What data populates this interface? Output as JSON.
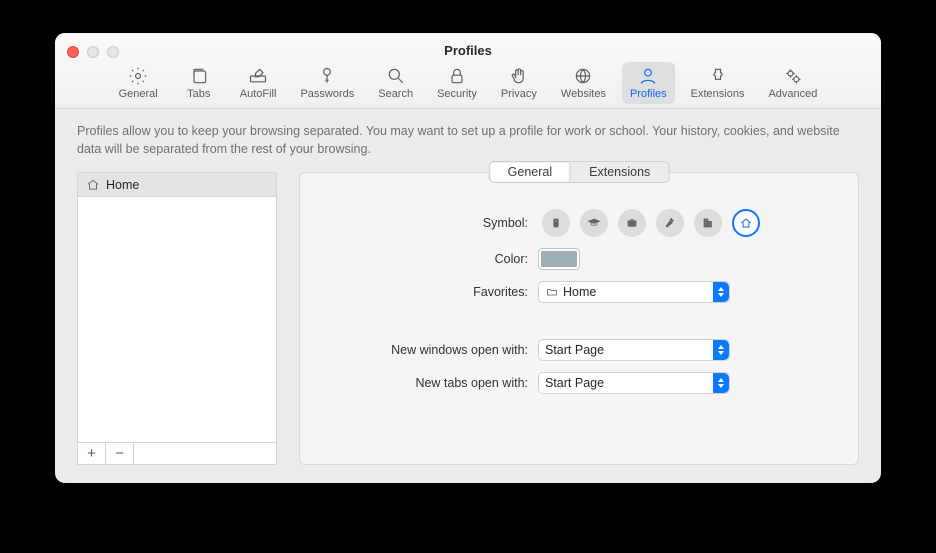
{
  "window": {
    "title": "Profiles"
  },
  "toolbar": {
    "items": [
      {
        "label": "General"
      },
      {
        "label": "Tabs"
      },
      {
        "label": "AutoFill"
      },
      {
        "label": "Passwords"
      },
      {
        "label": "Search"
      },
      {
        "label": "Security"
      },
      {
        "label": "Privacy"
      },
      {
        "label": "Websites"
      },
      {
        "label": "Profiles"
      },
      {
        "label": "Extensions"
      },
      {
        "label": "Advanced"
      }
    ]
  },
  "description": "Profiles allow you to keep your browsing separated. You may want to set up a profile for work or school. Your history, cookies, and website data will be separated from the rest of your browsing.",
  "sidebar": {
    "items": [
      {
        "label": "Home"
      }
    ],
    "add": "+",
    "remove": "−"
  },
  "segmented": {
    "general": "General",
    "extensions": "Extensions"
  },
  "form": {
    "symbol_label": "Symbol:",
    "color_label": "Color:",
    "color_value": "#9eafb1",
    "favorites_label": "Favorites:",
    "favorites_value": "Home",
    "new_windows_label": "New windows open with:",
    "new_windows_value": "Start Page",
    "new_tabs_label": "New tabs open with:",
    "new_tabs_value": "Start Page"
  }
}
